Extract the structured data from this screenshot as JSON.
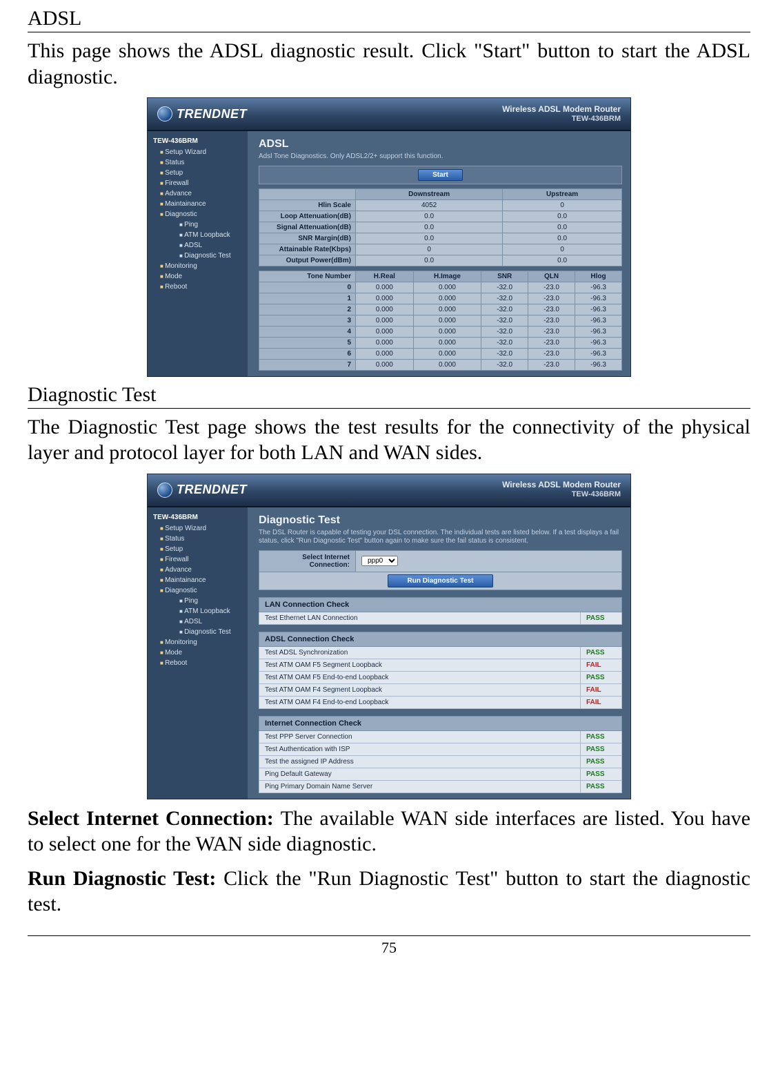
{
  "doc": {
    "sec1_heading": "ADSL",
    "sec1_body": "This page shows the ADSL diagnostic result. Click \"Start\" button to start the ADSL diagnostic.",
    "sec2_heading": "Diagnostic Test",
    "sec2_body": "The Diagnostic Test page shows the test results for the connectivity of the physical layer and protocol layer for both LAN and WAN sides.",
    "sel_label": "Select Internet Connection: ",
    "sel_desc": "The available WAN side interfaces are listed. You have to select one for the WAN side diagnostic.",
    "run_label": "Run Diagnostic Test: ",
    "run_desc": "Click the \"Run Diagnostic Test\" button to start the diagnostic test.",
    "page_number": "75"
  },
  "router": {
    "brand": "TRENDNET",
    "product_line1": "Wireless ADSL Modem Router",
    "product_line2": "TEW-436BRM",
    "nav_root": "TEW-436BRM",
    "nav": [
      "Setup Wizard",
      "Status",
      "Setup",
      "Firewall",
      "Advance",
      "Maintainance",
      "Diagnostic"
    ],
    "nav_diag_sub": [
      "Ping",
      "ATM Loopback",
      "ADSL",
      "Diagnostic Test"
    ],
    "nav_tail": [
      "Monitoring",
      "Mode",
      "Reboot"
    ]
  },
  "adsl": {
    "title": "ADSL",
    "desc": "Adsl Tone Diagnostics. Only ADSL2/2+ support this function.",
    "start_btn": "Start",
    "cols": [
      "Downstream",
      "Upstream"
    ],
    "metrics": [
      {
        "label": "Hlin Scale",
        "down": "4052",
        "up": "0"
      },
      {
        "label": "Loop Attenuation(dB)",
        "down": "0.0",
        "up": "0.0"
      },
      {
        "label": "Signal Attenuation(dB)",
        "down": "0.0",
        "up": "0.0"
      },
      {
        "label": "SNR Margin(dB)",
        "down": "0.0",
        "up": "0.0"
      },
      {
        "label": "Attainable Rate(Kbps)",
        "down": "0",
        "up": "0"
      },
      {
        "label": "Output Power(dBm)",
        "down": "0.0",
        "up": "0.0"
      }
    ],
    "tone_cols": [
      "Tone Number",
      "H.Real",
      "H.Image",
      "SNR",
      "QLN",
      "Hlog"
    ],
    "tones": [
      {
        "n": "0",
        "hr": "0.000",
        "hi": "0.000",
        "snr": "-32.0",
        "qln": "-23.0",
        "hlog": "-96.3"
      },
      {
        "n": "1",
        "hr": "0.000",
        "hi": "0.000",
        "snr": "-32.0",
        "qln": "-23.0",
        "hlog": "-96.3"
      },
      {
        "n": "2",
        "hr": "0.000",
        "hi": "0.000",
        "snr": "-32.0",
        "qln": "-23.0",
        "hlog": "-96.3"
      },
      {
        "n": "3",
        "hr": "0.000",
        "hi": "0.000",
        "snr": "-32.0",
        "qln": "-23.0",
        "hlog": "-96.3"
      },
      {
        "n": "4",
        "hr": "0.000",
        "hi": "0.000",
        "snr": "-32.0",
        "qln": "-23.0",
        "hlog": "-96.3"
      },
      {
        "n": "5",
        "hr": "0.000",
        "hi": "0.000",
        "snr": "-32.0",
        "qln": "-23.0",
        "hlog": "-96.3"
      },
      {
        "n": "6",
        "hr": "0.000",
        "hi": "0.000",
        "snr": "-32.0",
        "qln": "-23.0",
        "hlog": "-96.3"
      },
      {
        "n": "7",
        "hr": "0.000",
        "hi": "0.000",
        "snr": "-32.0",
        "qln": "-23.0",
        "hlog": "-96.3"
      }
    ]
  },
  "diag": {
    "title": "Diagnostic Test",
    "desc": "The DSL Router is capable of testing your DSL connection. The individual tests are listed below. If a test displays a fail status, click \"Run Diagnostic Test\" button again to make sure the fail status is consistent.",
    "select_label": "Select Internet Connection:",
    "select_value": "ppp0",
    "run_btn": "Run Diagnostic Test",
    "lan_hdr": "LAN Connection Check",
    "lan_rows": [
      {
        "name": "Test Ethernet LAN Connection",
        "res": "PASS"
      }
    ],
    "adsl_hdr": "ADSL Connection Check",
    "adsl_rows": [
      {
        "name": "Test ADSL Synchronization",
        "res": "PASS"
      },
      {
        "name": "Test ATM OAM F5 Segment Loopback",
        "res": "FAIL"
      },
      {
        "name": "Test ATM OAM F5 End-to-end Loopback",
        "res": "PASS"
      },
      {
        "name": "Test ATM OAM F4 Segment Loopback",
        "res": "FAIL"
      },
      {
        "name": "Test ATM OAM F4 End-to-end Loopback",
        "res": "FAIL"
      }
    ],
    "inet_hdr": "Internet Connection Check",
    "inet_rows": [
      {
        "name": "Test PPP Server Connection",
        "res": "PASS"
      },
      {
        "name": "Test Authentication with ISP",
        "res": "PASS"
      },
      {
        "name": "Test the assigned IP Address",
        "res": "PASS"
      },
      {
        "name": "Ping Default Gateway",
        "res": "PASS"
      },
      {
        "name": "Ping Primary Domain Name Server",
        "res": "PASS"
      }
    ]
  }
}
